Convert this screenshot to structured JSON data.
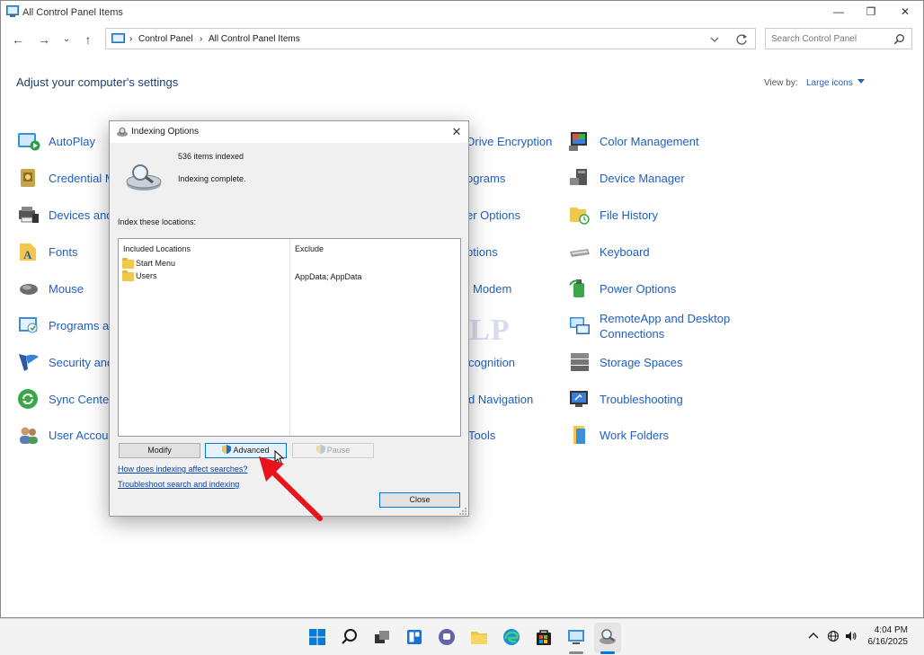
{
  "window": {
    "title": "All Control Panel Items",
    "minimize": "—",
    "maximize": "❐",
    "close": "✕"
  },
  "nav": {
    "back": "←",
    "forward": "→",
    "recent": "⌄",
    "up": "↑"
  },
  "address": {
    "segments": [
      "Control Panel",
      "All Control Panel Items"
    ],
    "separator": "›"
  },
  "search": {
    "placeholder": "Search Control Panel"
  },
  "heading": "Adjust your computer's settings",
  "view_by": {
    "label": "View by:",
    "value": "Large icons"
  },
  "items_col1": [
    {
      "label": "AutoPlay",
      "icon": "autoplay-icon"
    },
    {
      "label": "Credential M",
      "icon": "credential-manager-icon"
    },
    {
      "label": "Devices and",
      "icon": "devices-printers-icon"
    },
    {
      "label": "Fonts",
      "icon": "fonts-icon"
    },
    {
      "label": "Mouse",
      "icon": "mouse-icon"
    },
    {
      "label": "Programs ar",
      "icon": "programs-defaults-icon"
    },
    {
      "label": "Security and",
      "icon": "security-maintenance-icon"
    },
    {
      "label": "Sync Center",
      "icon": "sync-center-icon"
    },
    {
      "label": "User Accou",
      "icon": "user-accounts-icon"
    }
  ],
  "items_col2": [
    {
      "label": "Drive Encryption"
    },
    {
      "label": "ograms"
    },
    {
      "label": "er Options"
    },
    {
      "label": "ptions"
    },
    {
      "label": "Modem"
    },
    {
      "label": "cognition"
    },
    {
      "label": "d Navigation"
    },
    {
      "label": "Tools"
    }
  ],
  "items_col3": [
    {
      "label": "Color Management",
      "icon": "color-management-icon"
    },
    {
      "label": "Device Manager",
      "icon": "device-manager-icon"
    },
    {
      "label": "File History",
      "icon": "file-history-icon"
    },
    {
      "label": "Keyboard",
      "icon": "keyboard-icon"
    },
    {
      "label": "Power Options",
      "icon": "power-options-icon"
    },
    {
      "label": "RemoteApp and Desktop Connections",
      "icon": "remoteapp-icon"
    },
    {
      "label": "Storage Spaces",
      "icon": "storage-spaces-icon"
    },
    {
      "label": "Troubleshooting",
      "icon": "troubleshooting-icon"
    },
    {
      "label": "Work Folders",
      "icon": "work-folders-icon"
    }
  ],
  "watermark": "IT Pros HLP",
  "dialog": {
    "title": "Indexing Options",
    "close": "✕",
    "items_indexed": "536 items indexed",
    "status": "Indexing complete.",
    "locations_label": "Index these locations:",
    "columns": {
      "included": "Included Locations",
      "exclude": "Exclude"
    },
    "rows": [
      {
        "location": "Start Menu",
        "exclude": ""
      },
      {
        "location": "Users",
        "exclude": "AppData; AppData"
      }
    ],
    "buttons": {
      "modify": "Modify",
      "advanced": "Advanced",
      "pause": "Pause",
      "close": "Close"
    },
    "links": {
      "how": "How does indexing affect searches?",
      "troubleshoot": "Troubleshoot search and indexing"
    }
  },
  "taskbar": {
    "time": "4:04 PM",
    "date": "6/16/2025",
    "icons": [
      "windows-start-icon",
      "search-icon",
      "task-view-icon",
      "widgets-icon",
      "chat-icon",
      "file-explorer-icon",
      "edge-browser-icon",
      "store-icon",
      "control-panel-icon",
      "indexing-options-icon"
    ]
  },
  "colors": {
    "accent": "#0078d7",
    "link": "#1f5fbf",
    "arrow": "#e8141b"
  }
}
